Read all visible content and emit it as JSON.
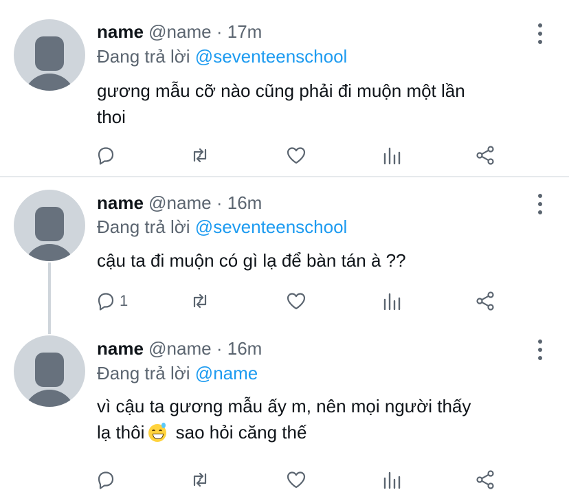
{
  "tweets": [
    {
      "name": "name",
      "handle": "@name",
      "separator": "·",
      "time": "17m",
      "replying_prefix": "Đang trả lời",
      "replying_to": "@seventeenschool",
      "text_line1": "gương mẫu cỡ nào cũng phải đi muộn một lần",
      "text_line2": "thoi",
      "reply_count": ""
    },
    {
      "name": "name",
      "handle": "@name",
      "separator": "·",
      "time": "16m",
      "replying_prefix": "Đang trả lời",
      "replying_to": "@seventeenschool",
      "text_line1": "cậu ta đi muộn có gì lạ để bàn tán à ??",
      "reply_count": "1"
    },
    {
      "name": "name",
      "handle": "@name",
      "separator": "·",
      "time": "16m",
      "replying_prefix": "Đang trả lời",
      "replying_to": "@name",
      "text_line1": "vì cậu ta gương mẫu ấy m, nên mọi người thấy",
      "text_line2_a": "lạ thôi",
      "text_line2_b": "sao hỏi căng thế",
      "reply_count": ""
    }
  ],
  "icons": {
    "reply": "reply-icon",
    "retweet": "retweet-icon",
    "like": "heart-icon",
    "views": "analytics-icon",
    "share": "share-icon",
    "more": "more-vertical-icon",
    "emoji": "grinning-sweat-emoji"
  },
  "colors": {
    "accent": "#1d9bf0",
    "secondary_text": "#5b6570",
    "avatar_bg": "#cfd5db",
    "avatar_fg": "#67717d"
  }
}
